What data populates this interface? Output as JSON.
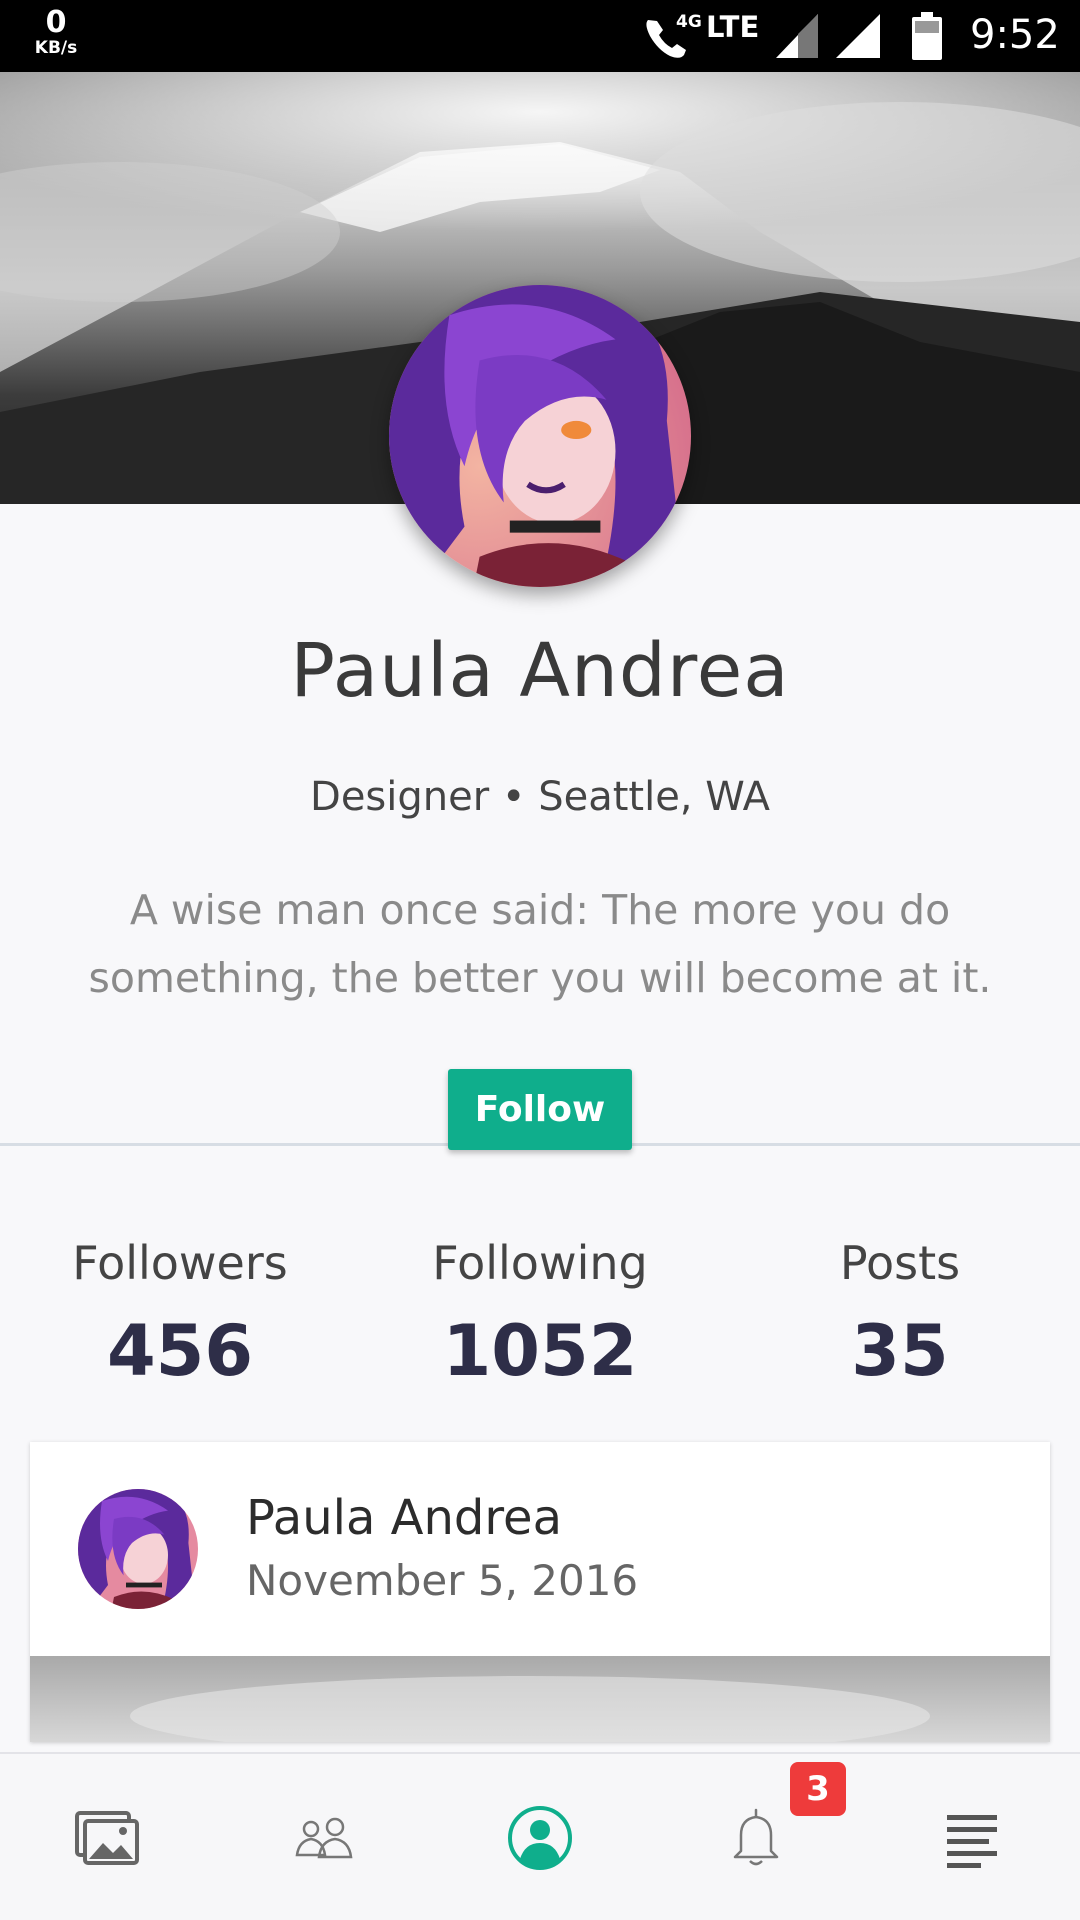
{
  "status_bar": {
    "speed_value": "0",
    "speed_unit": "KB/s",
    "network_4g": "4G",
    "network_lte": "LTE",
    "time": "9:52"
  },
  "profile": {
    "name": "Paula Andrea",
    "meta": "Designer • Seattle, WA",
    "bio": "A wise man once said: The more you do something, the better you will become at it.",
    "follow_label": "Follow"
  },
  "stats": {
    "followers_label": "Followers",
    "followers_value": "456",
    "following_label": "Following",
    "following_value": "1052",
    "posts_label": "Posts",
    "posts_value": "35"
  },
  "post": {
    "author": "Paula Andrea",
    "date": "November 5, 2016"
  },
  "bottom_nav": {
    "items": [
      "gallery-icon",
      "people-icon",
      "profile-icon",
      "bell-icon",
      "menu-icon"
    ],
    "active": "profile-icon",
    "notification_count": "3"
  },
  "colors": {
    "accent": "#0fae8c",
    "badge": "#ee3b3b",
    "stat_value": "#2e2e48"
  }
}
